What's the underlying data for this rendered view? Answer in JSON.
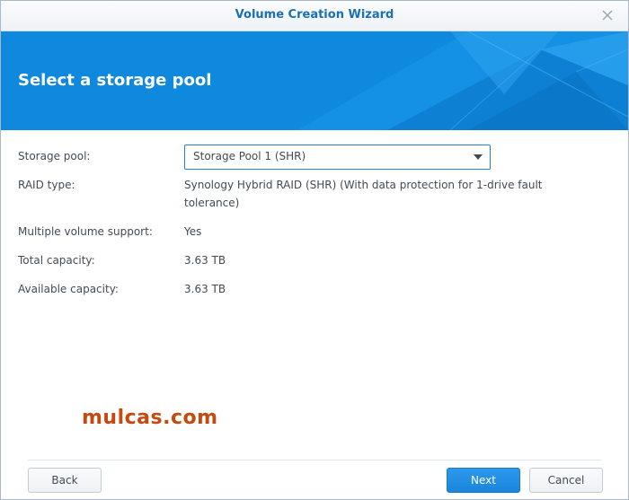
{
  "window": {
    "title": "Volume Creation Wizard"
  },
  "banner": {
    "title": "Select a storage pool"
  },
  "form": {
    "storage_pool": {
      "label": "Storage pool:",
      "selected": "Storage Pool 1 (SHR)"
    },
    "raid_type": {
      "label": "RAID type:",
      "value_line1": "Synology Hybrid RAID (SHR) (With data protection for 1-drive fault",
      "value_line2": "tolerance)"
    },
    "multiple_volume": {
      "label": "Multiple volume support:",
      "value": "Yes"
    },
    "total_capacity": {
      "label": "Total capacity:",
      "value": "3.63 TB"
    },
    "available_capacity": {
      "label": "Available capacity:",
      "value": "3.63 TB"
    }
  },
  "watermark": "mulcas.com",
  "buttons": {
    "back": "Back",
    "next": "Next",
    "cancel": "Cancel"
  },
  "icons": {
    "close": "close-icon",
    "dropdown": "chevron-down-icon"
  },
  "colors": {
    "accent": "#0e88dc",
    "title_text": "#1b6fb5",
    "watermark": "#c44a10"
  }
}
